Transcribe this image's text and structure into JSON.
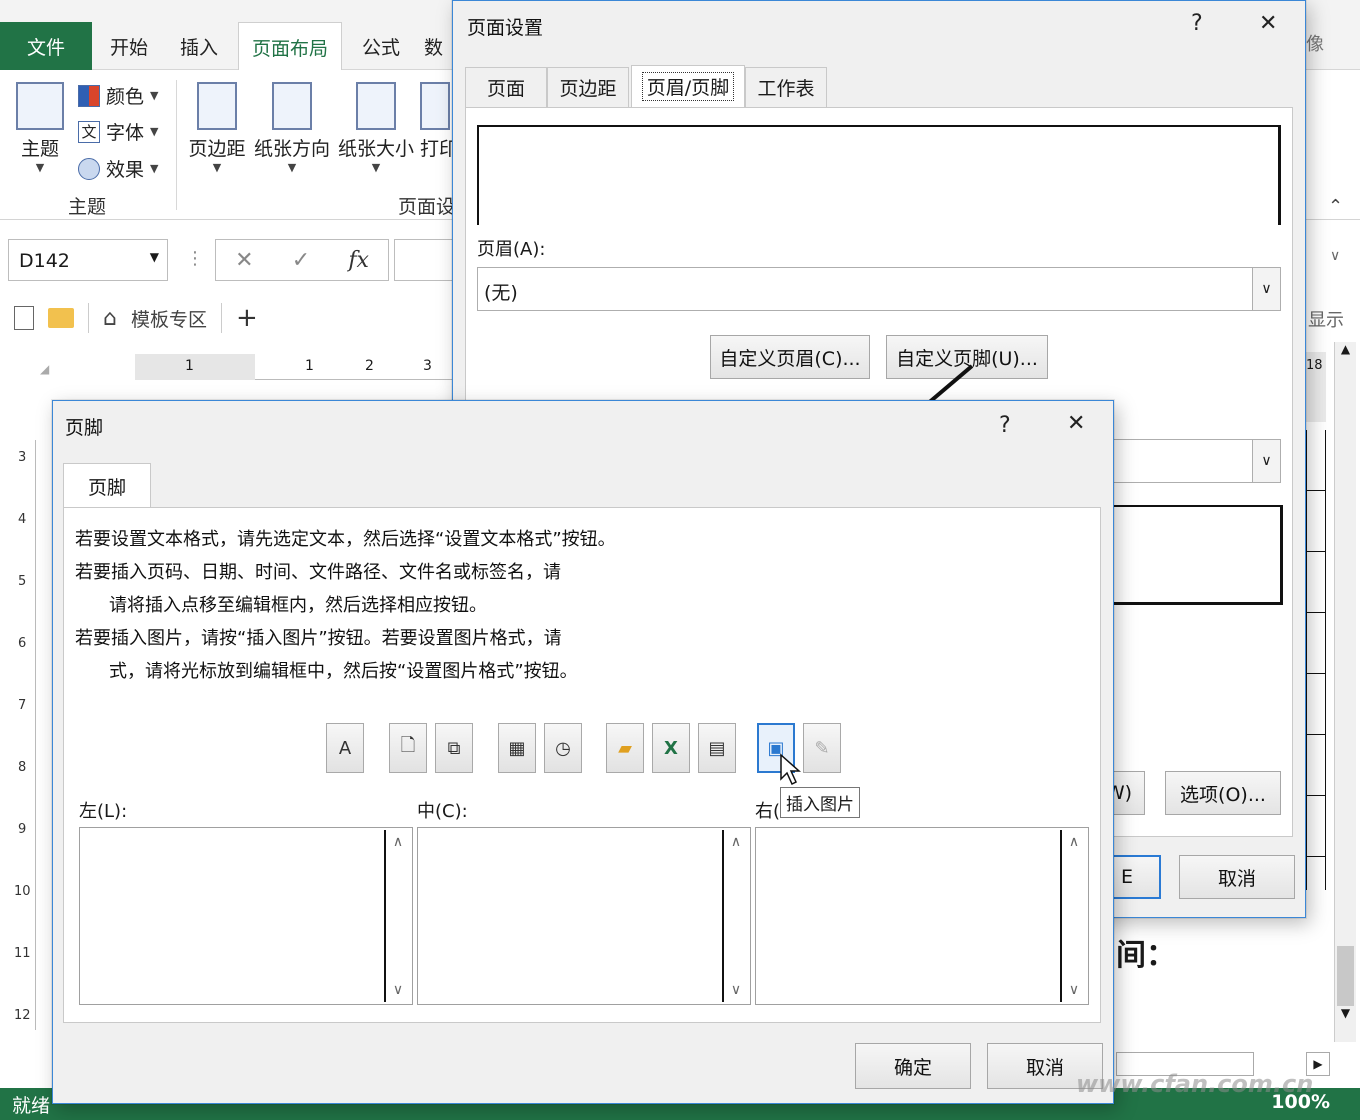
{
  "ribbon": {
    "tabs": [
      {
        "label": "文件"
      },
      {
        "label": "开始"
      },
      {
        "label": "插入"
      },
      {
        "label": "页面布局"
      },
      {
        "label": "公式"
      },
      {
        "label": "数"
      }
    ],
    "themes_label": "主题",
    "colors_label": "颜色",
    "fonts_label": "字体",
    "effects_label": "效果",
    "group_themes": "主题",
    "margins_label": "页边距",
    "orientation_label": "纸张方向",
    "size_label": "纸张大小",
    "print_label": "打印",
    "group_page_setup": "页面设",
    "right_edge_text": "显示",
    "right_edge_num": "18",
    "right_edge_char": "像"
  },
  "formula_bar": {
    "name_box": "D142",
    "fx": "fx"
  },
  "workbook_tabs": {
    "template_label": "模板专区",
    "add_label": "+"
  },
  "ruler": {
    "top_marks": [
      "1",
      "1",
      "2",
      "3"
    ],
    "left_marks": [
      "3",
      "4",
      "5",
      "6",
      "7",
      "8",
      "9",
      "10",
      "11",
      "12"
    ]
  },
  "status": {
    "ready": "就绪",
    "zoom": "100%"
  },
  "background_text": {
    "time_label": "间："
  },
  "page_setup": {
    "title": "页面设置",
    "help": "?",
    "close": "✕",
    "tabs": [
      "页面",
      "页边距",
      "页眉/页脚",
      "工作表"
    ],
    "header_label": "页眉(A):",
    "header_value": "(无)",
    "custom_header_btn": "自定义页眉(C)...",
    "custom_footer_btn": "自定义页脚(U)...",
    "print_preview_partial": "W)",
    "options_btn": "选项(O)...",
    "ok_partial": "E",
    "cancel_btn": "取消"
  },
  "footer_dialog": {
    "title": "页脚",
    "help": "?",
    "close": "✕",
    "tab": "页脚",
    "instructions": [
      "若要设置文本格式，请先选定文本，然后选择“设置文本格式”按钮。",
      "若要插入页码、日期、时间、文件路径、文件名或标签名，请",
      "请将插入点移至编辑框内，然后选择相应按钮。",
      "若要插入图片，请按“插入图片”按钮。若要设置图片格式，请",
      "式，请将光标放到编辑框中，然后按“设置图片格式”按钮。"
    ],
    "toolbar": {
      "format_text": "A"
    },
    "tooltip": "插入图片",
    "left_label": "左(L):",
    "center_label": "中(C):",
    "right_label": "右(",
    "ok_btn": "确定",
    "cancel_btn": "取消"
  },
  "watermark": "www.cfan.com.cn"
}
